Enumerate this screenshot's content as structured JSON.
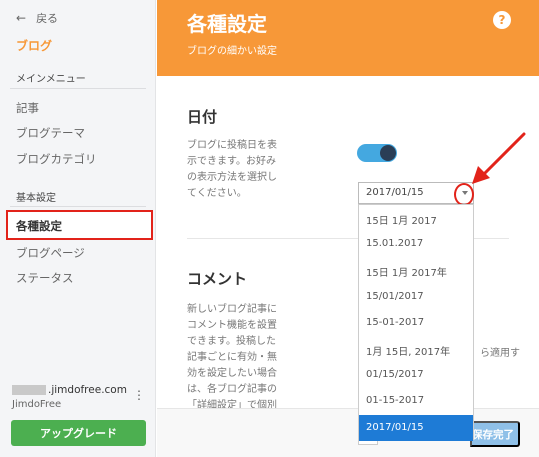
{
  "sidebar": {
    "back_label": "戻る",
    "blog_label": "ブログ",
    "main_menu_label": "メインメニュー",
    "main_items": [
      {
        "label": "記事"
      },
      {
        "label": "ブログテーマ"
      },
      {
        "label": "ブログカテゴリ"
      }
    ],
    "basic_settings_label": "基本設定",
    "settings_items": [
      {
        "label": "各種設定"
      },
      {
        "label": "ブログページ"
      },
      {
        "label": "ステータス"
      }
    ],
    "account_domain": ".jimdofree.com",
    "account_plan": "JimdoFree",
    "upgrade_label": "アップグレード"
  },
  "header": {
    "title": "各種設定",
    "subtitle": "ブログの細かい設定",
    "help_label": "?"
  },
  "date_section": {
    "title": "日付",
    "description": "ブログに投稿日を表\n示できます。お好み\nの表示方法を選択し\nてください。",
    "toggle_on": true,
    "selected_format": "2017/01/15",
    "options": [
      "15日 1月 2017",
      "15.01.2017",
      "15日 1月 2017年",
      "15/01/2017",
      "15-01-2017",
      "1月 15日, 2017年",
      "01/15/2017",
      "01-15-2017",
      "2017/01/15"
    ]
  },
  "comment_section": {
    "title": "コメント",
    "description": "新しいブログ記事に\nコメント機能を設置\nできます。投稿した\n記事ごとに有効・無\n効を設定したい場合\nは、各ブログ記事の\n「詳細設定」で個別",
    "apply_text": "ら適用す",
    "save_label": "保存完了"
  },
  "colors": {
    "accent_orange": "#f79838",
    "upgrade_green": "#4caf50",
    "toggle_blue": "#44a8e0",
    "selected_blue": "#1e7bd6",
    "annotation_red": "#e2231a"
  }
}
